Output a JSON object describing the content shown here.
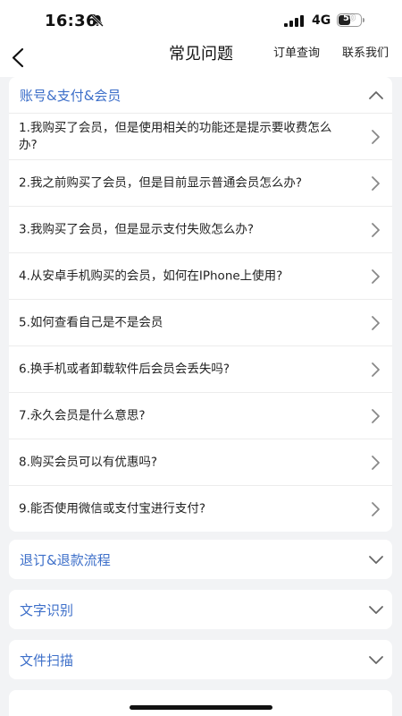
{
  "status_bar": {
    "time": "16:36",
    "network": "4G",
    "battery": "50"
  },
  "nav": {
    "title": "常见问题",
    "order_query": "订单查询",
    "contact_us": "联系我们"
  },
  "sections": [
    {
      "title": "账号&支付&会员",
      "expanded": true,
      "questions": [
        "1.我购买了会员，但是使用相关的功能还是提示要收费怎么办?",
        "2.我之前购买了会员，但是目前显示普通会员怎么办?",
        "3.我购买了会员，但是显示支付失败怎么办?",
        "4.从安卓手机购买的会员，如何在IPhone上使用?",
        "5.如何查看自己是不是会员",
        "6.换手机或者卸载软件后会员会丢失吗?",
        "7.永久会员是什么意思?",
        "8.购买会员可以有优惠吗?",
        "9.能否使用微信或支付宝进行支付?"
      ]
    },
    {
      "title": "退订&退款流程",
      "expanded": false
    },
    {
      "title": "文字识别",
      "expanded": false
    },
    {
      "title": "文件扫描",
      "expanded": false
    }
  ],
  "colors": {
    "accent": "#3d6fc9",
    "background": "#f2f3f5"
  }
}
